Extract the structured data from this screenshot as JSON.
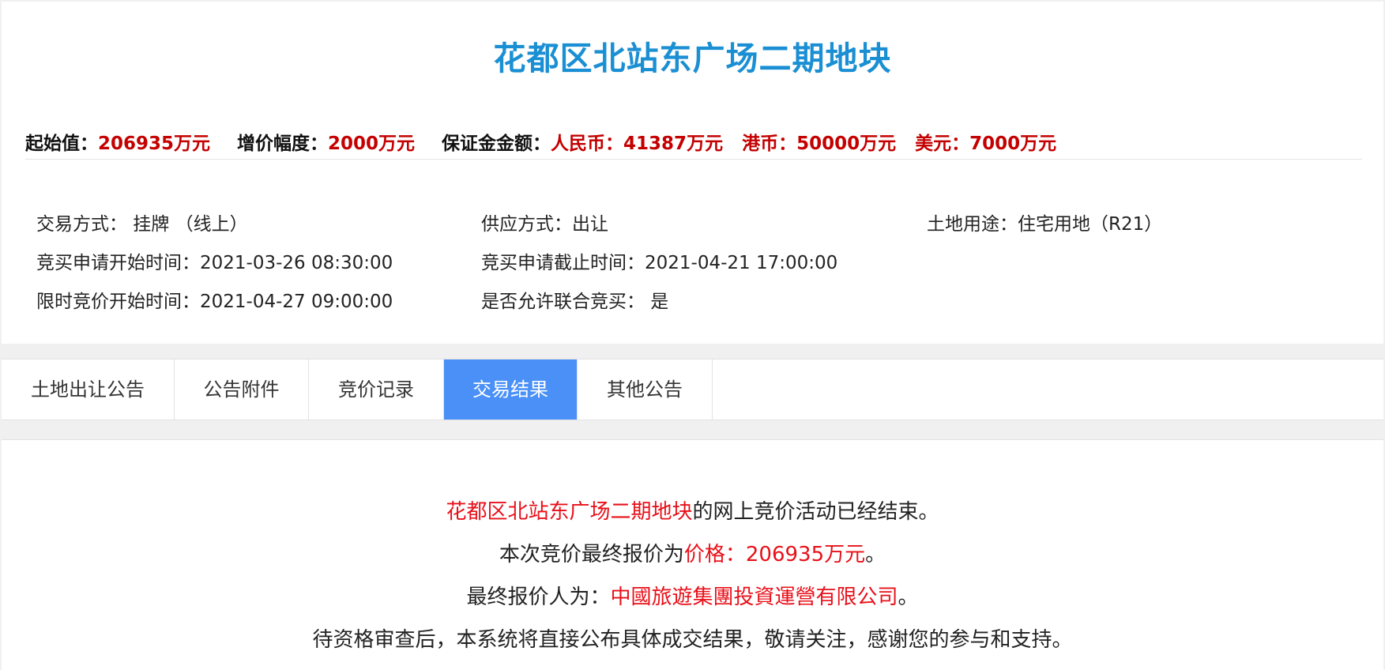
{
  "header": {
    "title": "花都区北站东广场二期地块"
  },
  "prices": {
    "start_label": "起始值：",
    "start_value": "206935万元",
    "increment_label": "增价幅度：",
    "increment_value": "2000万元",
    "deposit_label": "保证金金额：",
    "rmb": "人民币：41387万元",
    "hkd": "港币：50000万元",
    "usd": "美元：7000万元"
  },
  "info": {
    "trade_method": "交易方式：  挂牌 （线上）",
    "supply_method": "供应方式：出让",
    "land_use": "土地用途：住宅用地（R21）",
    "apply_start": "竞买申请开始时间：2021-03-26 08:30:00",
    "apply_end": "竞买申请截止时间：2021-04-21 17:00:00",
    "bid_start": "限时竞价开始时间：2021-04-27 09:00:00",
    "joint_bid": "是否允许联合竞买：  是"
  },
  "tabs": [
    {
      "label": "土地出让公告",
      "active": false
    },
    {
      "label": "公告附件",
      "active": false
    },
    {
      "label": "竞价记录",
      "active": false
    },
    {
      "label": "交易结果",
      "active": true
    },
    {
      "label": "其他公告",
      "active": false
    }
  ],
  "result": {
    "land_name": "花都区北站东广场二期地块",
    "line1_suffix": "的网上竞价活动已经结束。",
    "line2_prefix": "本次竞价最终报价为",
    "line2_price": "价格：206935万元",
    "line2_suffix": "。",
    "line3_prefix": "最终报价人为：",
    "line3_bidder": "中國旅遊集團投資運營有限公司",
    "line3_suffix": "。",
    "line4": "待资格审查后，本系统将直接公布具体成交结果，敬请关注，感谢您的参与和支持。"
  },
  "colors": {
    "title": "#1b8fd3",
    "price_red": "#c40000",
    "result_red": "#e8101a",
    "active_tab": "#4a90f7"
  }
}
